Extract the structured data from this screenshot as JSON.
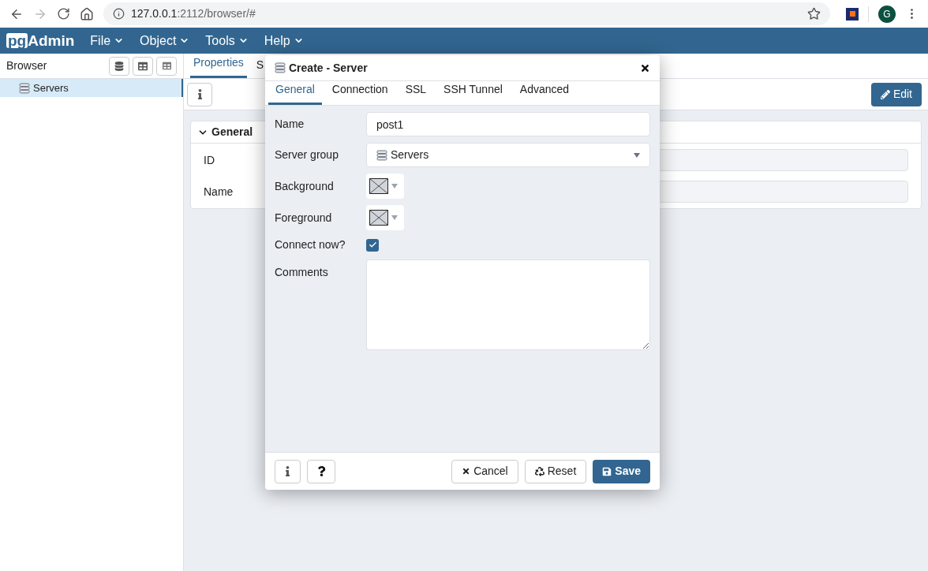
{
  "browser": {
    "url_host": "127.0.0.1",
    "url_rest": ":2112/browser/#",
    "avatar": "G"
  },
  "app": {
    "logo_pg": "pg",
    "logo_rest": "Admin",
    "menus": [
      "File",
      "Object",
      "Tools",
      "Help"
    ]
  },
  "sidebar": {
    "title": "Browser",
    "items": [
      {
        "label": "Servers",
        "selected": true
      }
    ]
  },
  "main": {
    "tabs": [
      {
        "label": "Properties",
        "selected": true
      },
      {
        "label": "S",
        "selected": false
      }
    ],
    "edit_button": "Edit",
    "section": {
      "title": "General",
      "expanded": true,
      "fields": [
        "ID",
        "Name"
      ]
    }
  },
  "dialog": {
    "title": "Create - Server",
    "tabs": [
      {
        "label": "General",
        "selected": true
      },
      {
        "label": "Connection",
        "selected": false
      },
      {
        "label": "SSL",
        "selected": false
      },
      {
        "label": "SSH Tunnel",
        "selected": false
      },
      {
        "label": "Advanced",
        "selected": false
      }
    ],
    "fields": [
      {
        "kind": "text",
        "label": "Name",
        "value": "post1"
      },
      {
        "kind": "select",
        "label": "Server group",
        "value": "Servers"
      },
      {
        "kind": "color",
        "label": "Background"
      },
      {
        "kind": "color",
        "label": "Foreground"
      },
      {
        "kind": "checkbox",
        "label": "Connect now?",
        "checked": true
      },
      {
        "kind": "textarea",
        "label": "Comments"
      }
    ],
    "buttons": {
      "cancel": "Cancel",
      "reset": "Reset",
      "save": "Save"
    }
  }
}
